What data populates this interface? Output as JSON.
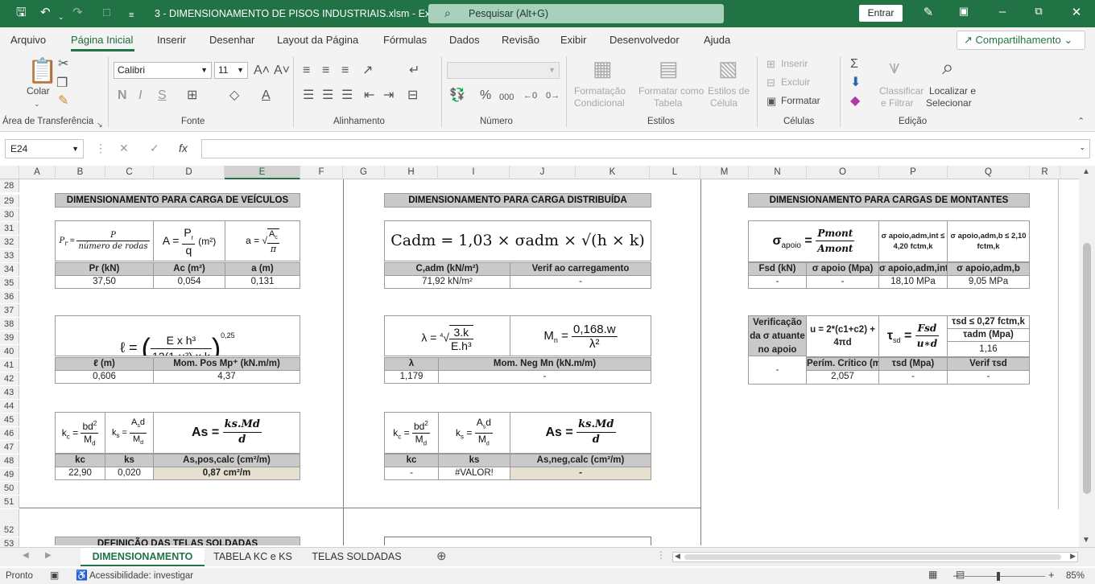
{
  "titlebar": {
    "title": "3 - DIMENSIONAMENTO DE PISOS INDUSTRIAIS.xlsm  -  Excel",
    "search_placeholder": "Pesquisar (Alt+G)",
    "signin": "Entrar"
  },
  "menu": {
    "items": [
      "Arquivo",
      "Página Inicial",
      "Inserir",
      "Desenhar",
      "Layout da Página",
      "Fórmulas",
      "Dados",
      "Revisão",
      "Exibir",
      "Desenvolvedor",
      "Ajuda"
    ],
    "active": "Página Inicial",
    "share": "Compartilhamento"
  },
  "ribbon": {
    "clipboard": {
      "paste": "Colar",
      "label": "Área de Transferência"
    },
    "font": {
      "name": "Calibri",
      "size": "11",
      "label": "Fonte",
      "bold": "N",
      "italic": "I",
      "underline": "S"
    },
    "alignment": {
      "label": "Alinhamento"
    },
    "number": {
      "label": "Número"
    },
    "styles": {
      "cond_format": [
        "Formatação",
        "Condicional"
      ],
      "format_table": [
        "Formatar como",
        "Tabela"
      ],
      "cell_styles": [
        "Estilos de",
        "Célula"
      ],
      "label": "Estilos"
    },
    "cells": {
      "insert": "Inserir",
      "delete": "Excluir",
      "format": "Formatar",
      "label": "Células"
    },
    "editing": {
      "sort_filter": [
        "Classificar",
        "e Filtrar"
      ],
      "find_select": [
        "Localizar e",
        "Selecionar"
      ],
      "label": "Edição"
    }
  },
  "formula_bar": {
    "name_box": "E24",
    "formula": ""
  },
  "columns": [
    "A",
    "B",
    "C",
    "D",
    "E",
    "F",
    "G",
    "H",
    "I",
    "J",
    "K",
    "L",
    "M",
    "N",
    "O",
    "P",
    "Q",
    "R"
  ],
  "rows": [
    "28",
    "29",
    "30",
    "31",
    "32",
    "33",
    "34",
    "35",
    "36",
    "37",
    "38",
    "39",
    "40",
    "41",
    "42",
    "43",
    "44",
    "45",
    "46",
    "47",
    "48",
    "49",
    "50",
    "51",
    "52",
    "53"
  ],
  "sheet": {
    "veiculos": {
      "title": "DIMENSIONAMENTO PARA CARGA DE VEÍCULOS",
      "f1": {
        "lhs": "P",
        "sub": "r",
        "num": "P",
        "den": "número de rodas"
      },
      "f2": {
        "lhs": "A",
        "num": "P",
        "sub": "r",
        "den": "q",
        "unit": "(m²)"
      },
      "f3": {
        "lhs": "a",
        "num": "A",
        "sub": "c",
        "den": "π"
      },
      "h1": [
        "Pr (kN)",
        "Ac (m²)",
        "a (m)"
      ],
      "v1": [
        "37,50",
        "0,054",
        "0,131"
      ],
      "f4": {
        "lhs": "ℓ",
        "num": "E x h³",
        "den": "12(1-μ²) x k",
        "exp": "0,25"
      },
      "h2": [
        "ℓ (m)",
        "Mom. Pos Mp⁺ (kN.m/m)"
      ],
      "v2": [
        "0,606",
        "4,37"
      ],
      "h3": [
        "kc",
        "ks",
        "As,pos,calc (cm²/m)"
      ],
      "v3": [
        "22,90",
        "0,020",
        "0,87 cm²/m"
      ],
      "next_title": "DEFINIÇÃO DAS TELAS SOLDADAS"
    },
    "distribuida": {
      "title": "DIMENSIONAMENTO PARA CARGA DISTRIBUÍDA",
      "formula_main": "Cadm = 1,03 × σadm × √(h × k)",
      "h1": [
        "C,adm (kN/m²)",
        "Verif ao carregamento"
      ],
      "v1": [
        "71,92 kN/m²",
        "-"
      ],
      "f_lambda": {
        "lhs": "λ",
        "num": "3.k",
        "den": "E.h³",
        "root": "4"
      },
      "f_mn": {
        "lhs": "M",
        "sub": "n",
        "num": "0,168.w",
        "den": "λ²"
      },
      "h2": [
        "λ",
        "Mom. Neg Mn (kN.m/m)"
      ],
      "v2": [
        "1,179",
        "-"
      ],
      "h3": [
        "kc",
        "ks",
        "As,neg,calc (cm²/m)"
      ],
      "v3": [
        "-",
        "#VALOR!",
        "-"
      ]
    },
    "montantes": {
      "title": "DIMENSIONAMENTO PARA CARGAS DE MONTANTES",
      "f_sigma": {
        "lhs": "σ",
        "sub": "apoio",
        "num": "Pmont",
        "den": "Amont"
      },
      "cond1": "σ apoio,adm,int ≤ 4,20 fctm,k",
      "cond2": "σ apoio,adm,b ≤ 2,10 fctm,k",
      "h1": [
        "Fsd (kN)",
        "σ apoio  (Mpa)",
        "σ apoio,adm,int",
        "σ apoio,adm,b"
      ],
      "v1": [
        "-",
        "-",
        "18,10 MPa",
        "9,05 MPa"
      ],
      "verif_label": "Verificação da σ atuante no apoio",
      "verif_value": "-",
      "u_formula": "u = 2*(c1+c2) + 4πd",
      "tau_formula": {
        "lhs": "τ",
        "sub": "sd",
        "num": "Fsd",
        "den": "u∗d"
      },
      "tau_cond": "τsd ≤ 0,27 fctm,k",
      "tau_adm_label": "τadm (Mpa)",
      "tau_adm": "1,16",
      "h2": [
        "Perím. Crítico (m)",
        "τsd (Mpa)",
        "Verif τsd"
      ],
      "v2": [
        "2,057",
        "-",
        "-"
      ]
    }
  },
  "kc_formula": {
    "lhs": "k",
    "sub": "c",
    "num": "bd",
    "sup": "2",
    "den": "M",
    "den_sub": "d"
  },
  "ks_formula": {
    "lhs": "k",
    "sub": "s",
    "num": "A",
    "num_sub": "s",
    "num_tail": "d",
    "den": "M",
    "den_sub": "d"
  },
  "as_formula": {
    "lhs": "As",
    "num": "ks.Md",
    "den": "d"
  },
  "tabs": [
    "DIMENSIONAMENTO",
    "TABELA KC e KS",
    "TELAS SOLDADAS"
  ],
  "active_tab": "DIMENSIONAMENTO",
  "status": {
    "ready": "Pronto",
    "accessibility": "Acessibilidade: investigar",
    "zoom": "85%"
  }
}
